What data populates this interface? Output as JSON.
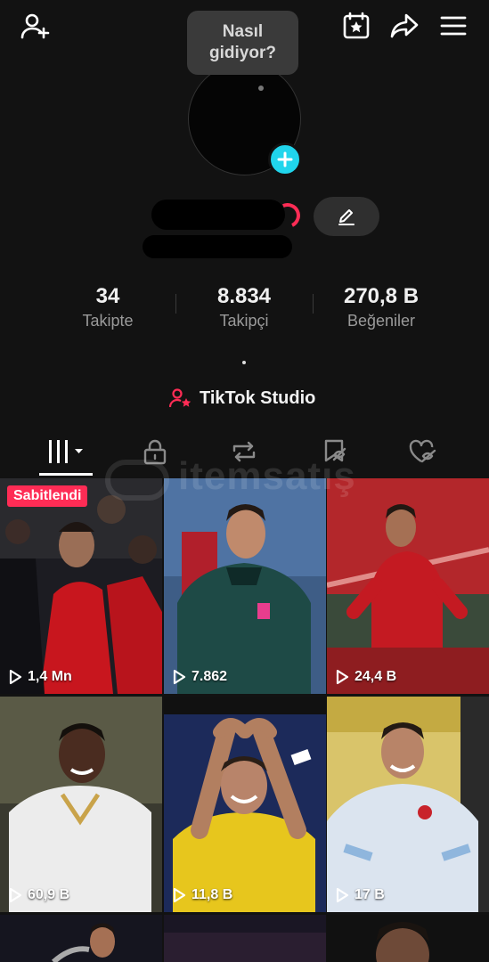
{
  "header": {
    "add_friend_icon": "person-add-icon",
    "calendar_icon": "calendar-star-icon",
    "share_icon": "share-icon",
    "menu_icon": "hamburger-menu-icon"
  },
  "profile": {
    "status_bubble": "Nasıl gidiyor?",
    "add_icon": "plus-icon",
    "edit_icon": "pencil-icon"
  },
  "stats": [
    {
      "value": "34",
      "label": "Takipte"
    },
    {
      "value": "8.834",
      "label": "Takipçi"
    },
    {
      "value": "270,8 B",
      "label": "Beğeniler"
    }
  ],
  "bio": {
    "text": "."
  },
  "studio": {
    "label": "TikTok Studio",
    "icon": "person-star-icon"
  },
  "tabs": [
    {
      "name": "videos",
      "icon": "grid-icon"
    },
    {
      "name": "private",
      "icon": "lock-icon"
    },
    {
      "name": "reposts",
      "icon": "repost-icon"
    },
    {
      "name": "favorites",
      "icon": "bookmark-hidden-icon"
    },
    {
      "name": "liked",
      "icon": "heart-hidden-icon"
    }
  ],
  "watermark": "itemsatış",
  "videos": [
    {
      "views": "1,4 Mn",
      "pinned": "Sabitlendi"
    },
    {
      "views": "7.862"
    },
    {
      "views": "24,4 B"
    },
    {
      "views": "60,9 B"
    },
    {
      "views": "11,8 B"
    },
    {
      "views": "17 B"
    },
    {
      "views": ""
    },
    {
      "views": ""
    },
    {
      "views": ""
    }
  ],
  "colors": {
    "background": "#121212",
    "accent_red": "#fe2c55",
    "accent_cyan": "#20d5ec"
  }
}
